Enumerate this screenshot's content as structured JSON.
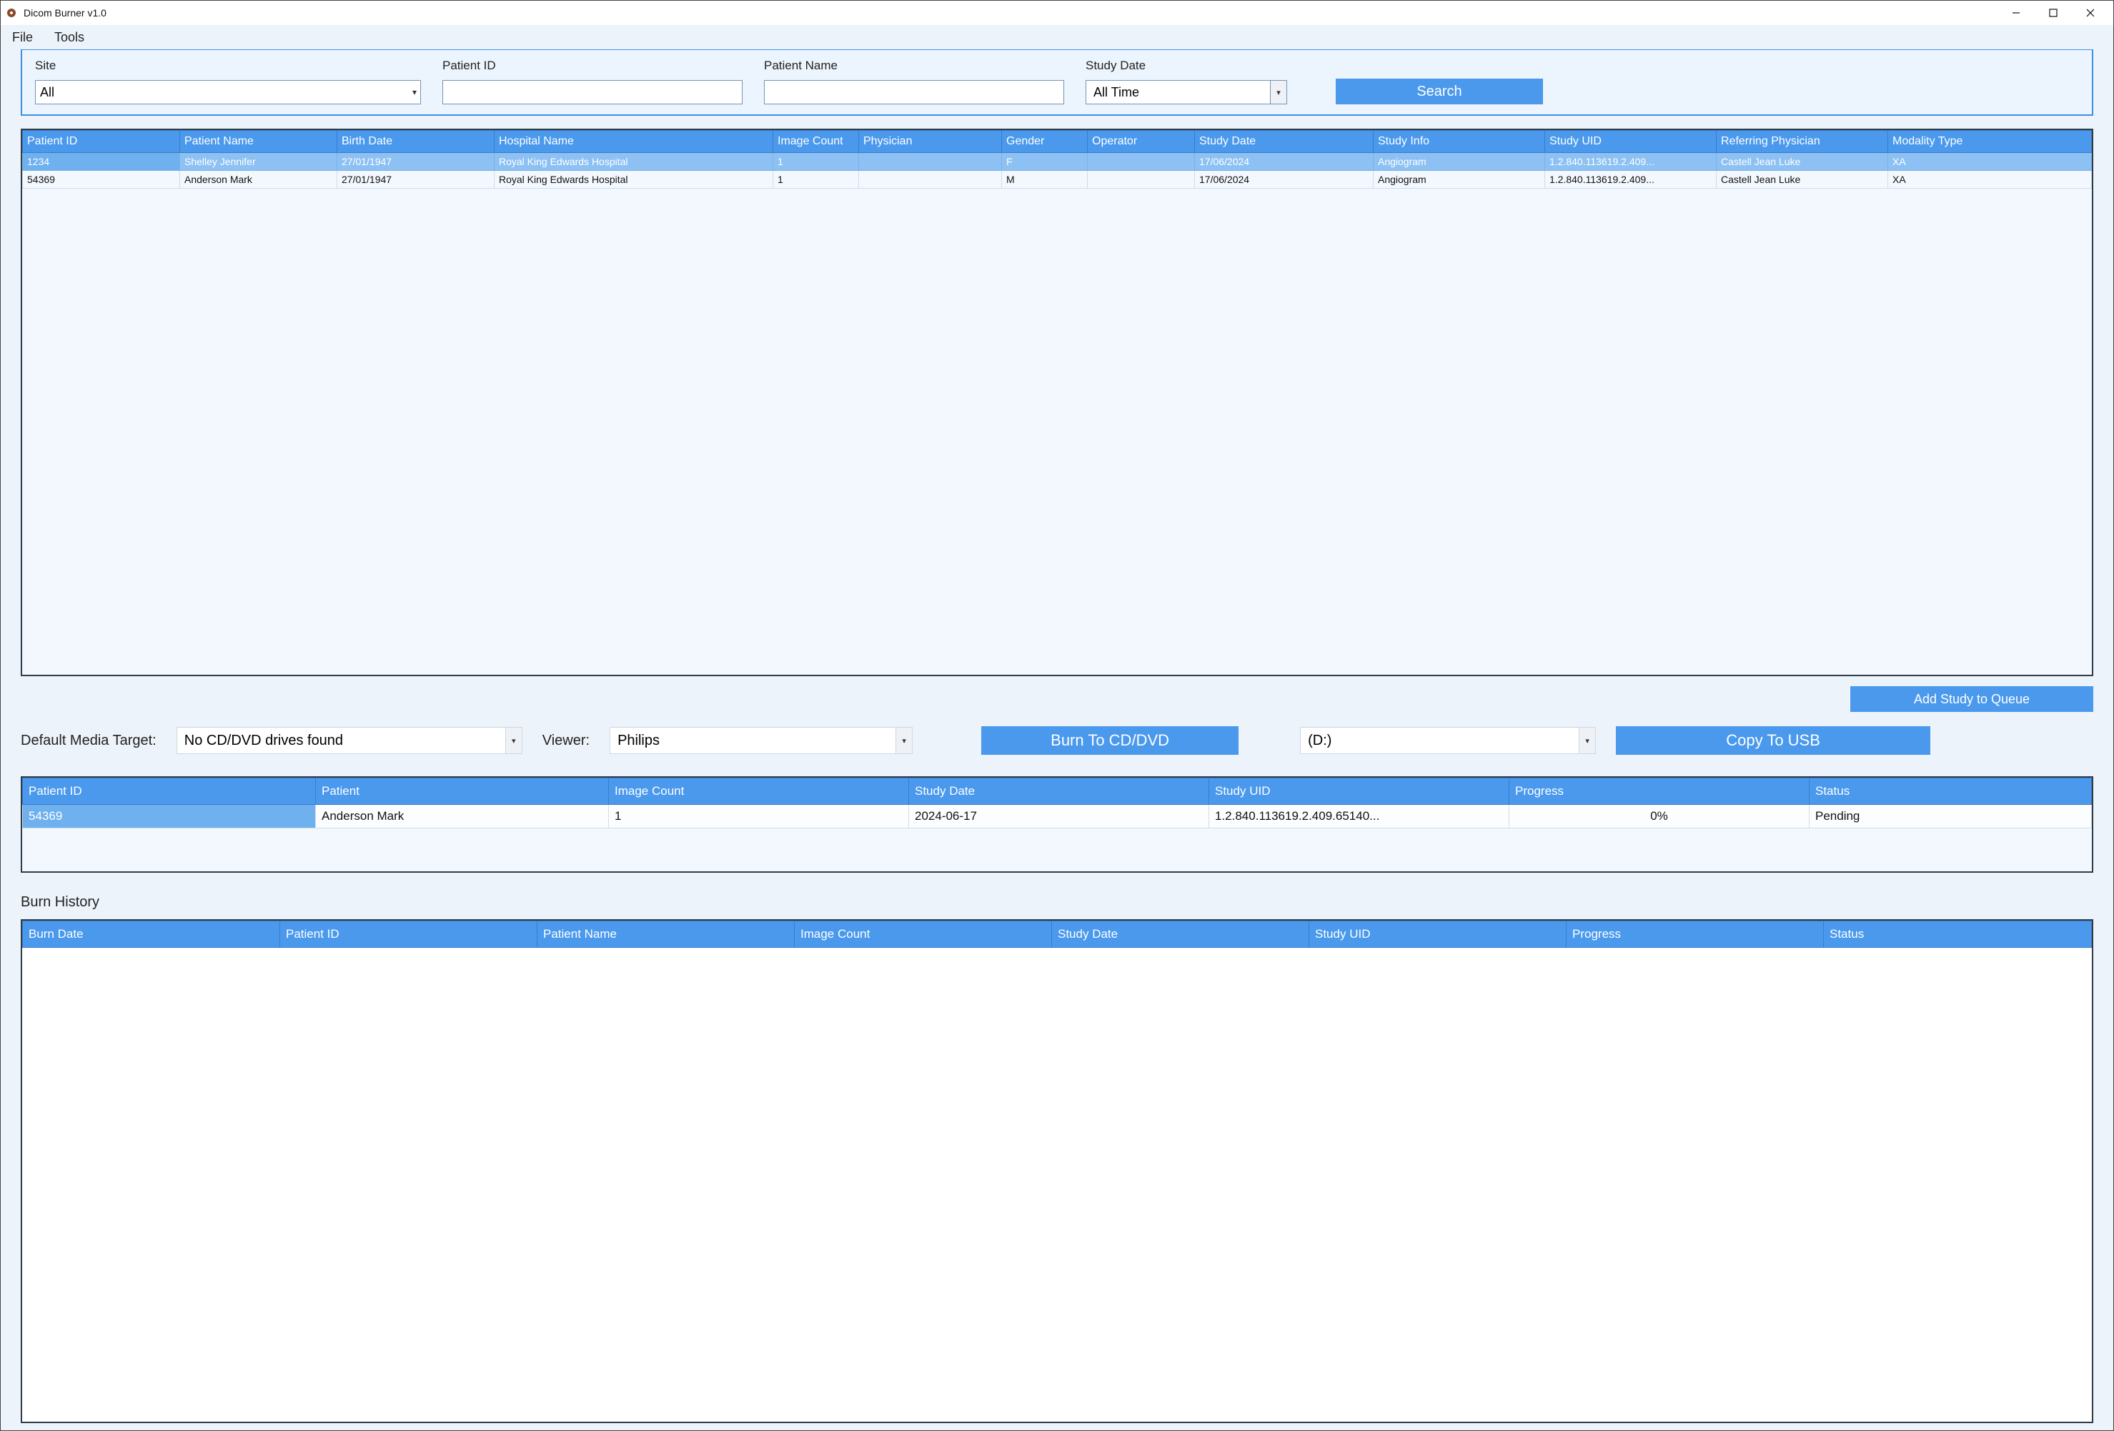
{
  "window": {
    "title": "Dicom Burner v1.0"
  },
  "menu": {
    "file": "File",
    "tools": "Tools"
  },
  "search": {
    "site_label": "Site",
    "site_value": "All",
    "patient_id_label": "Patient ID",
    "patient_id_value": "",
    "patient_name_label": "Patient Name",
    "patient_name_value": "",
    "study_date_label": "Study Date",
    "study_date_value": "All Time",
    "button": "Search"
  },
  "results": {
    "headers": {
      "patient_id": "Patient ID",
      "patient_name": "Patient Name",
      "birth_date": "Birth Date",
      "hospital_name": "Hospital Name",
      "image_count": "Image Count",
      "physician": "Physician",
      "gender": "Gender",
      "operator": "Operator",
      "study_date": "Study Date",
      "study_info": "Study Info",
      "study_uid": "Study UID",
      "ref_physician": "Referring Physician",
      "modality": "Modality Type"
    },
    "rows": [
      {
        "patient_id": "1234",
        "patient_name": "Shelley Jennifer",
        "birth_date": "27/01/1947",
        "hospital_name": "Royal King Edwards Hospital",
        "image_count": "1",
        "physician": "",
        "gender": "F",
        "operator": "",
        "study_date": "17/06/2024",
        "study_info": "Angiogram",
        "study_uid": "1.2.840.113619.2.409...",
        "ref_physician": "Castell Jean Luke",
        "modality": "XA",
        "selected": true
      },
      {
        "patient_id": "54369",
        "patient_name": "Anderson Mark",
        "birth_date": "27/01/1947",
        "hospital_name": "Royal King Edwards Hospital",
        "image_count": "1",
        "physician": "",
        "gender": "M",
        "operator": "",
        "study_date": "17/06/2024",
        "study_info": "Angiogram",
        "study_uid": "1.2.840.113619.2.409...",
        "ref_physician": "Castell Jean Luke",
        "modality": "XA",
        "selected": false
      }
    ]
  },
  "add_study_btn": "Add Study to Queue",
  "media": {
    "default_target_label": "Default Media Target:",
    "default_target_value": "No CD/DVD drives found",
    "viewer_label": "Viewer:",
    "viewer_value": "Philips",
    "burn_btn": "Burn To CD/DVD",
    "drive_value": "(D:)",
    "copy_btn": "Copy To USB"
  },
  "queue": {
    "headers": {
      "patient_id": "Patient ID",
      "patient": "Patient",
      "image_count": "Image Count",
      "study_date": "Study Date",
      "study_uid": "Study UID",
      "progress": "Progress",
      "status": "Status"
    },
    "rows": [
      {
        "patient_id": "54369",
        "patient": "Anderson Mark",
        "image_count": "1",
        "study_date": "2024-06-17",
        "study_uid": "1.2.840.113619.2.409.65140...",
        "progress": "0%",
        "status": "Pending"
      }
    ]
  },
  "history": {
    "label": "Burn History",
    "headers": {
      "burn_date": "Burn Date",
      "patient_id": "Patient ID",
      "patient_name": "Patient Name",
      "image_count": "Image Count",
      "study_date": "Study Date",
      "study_uid": "Study UID",
      "progress": "Progress",
      "status": "Status"
    }
  }
}
